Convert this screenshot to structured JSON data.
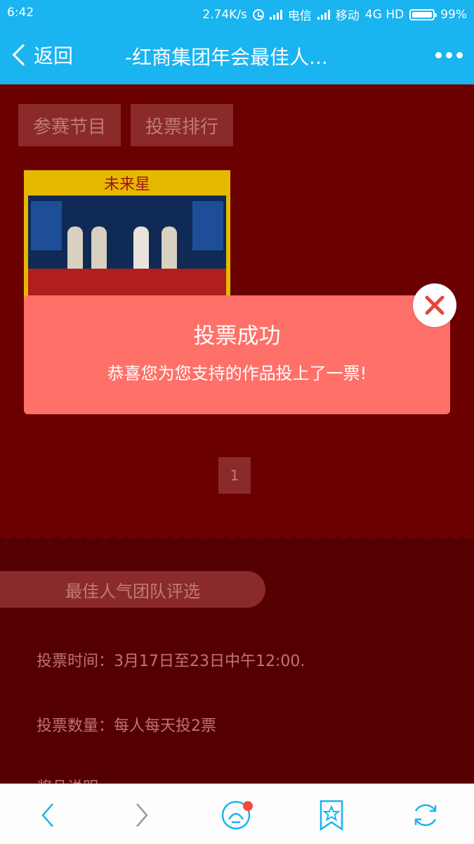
{
  "status_bar": {
    "time": "6:42",
    "speed": "2.74K/s",
    "carrier1": "电信",
    "carrier2": "移动",
    "network": "4G HD",
    "battery": "99%"
  },
  "header": {
    "back_label": "返回",
    "title": "-红商集团年会最佳人..."
  },
  "tabs": [
    {
      "label": "参赛节目"
    },
    {
      "label": "投票排行"
    }
  ],
  "card": {
    "title": "未来星"
  },
  "pagination": {
    "current_page": "1"
  },
  "section": {
    "pill_label": "最佳人气团队评选",
    "info": [
      "投票时间：3月17日至23日中午12:00.",
      "投票数量：每人每天投2票",
      "奖品说明"
    ]
  },
  "popup": {
    "title": "投票成功",
    "message": "恭喜您为您支持的作品投上了一票!"
  },
  "colors": {
    "accent": "#1ab4f0",
    "background": "#6b0000",
    "popup": "#ff7068",
    "close_x": "#e8453c",
    "nav_icon": "#1ab4f0"
  },
  "bottom_nav": {
    "icons": [
      "back-icon",
      "forward-icon",
      "home-icon",
      "bookmark-icon",
      "refresh-icon"
    ]
  }
}
